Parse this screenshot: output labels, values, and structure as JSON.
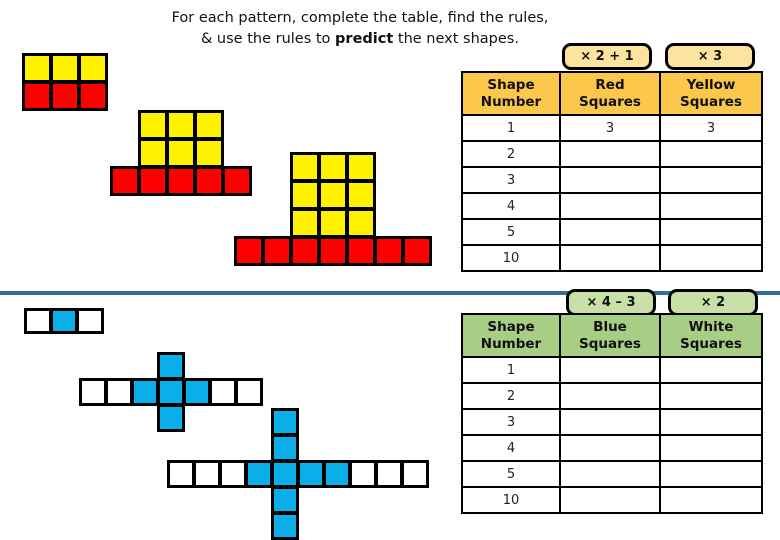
{
  "title": {
    "line1": "For each pattern, complete the table, find the rules,",
    "line2_pre": "& use the rules to ",
    "line2_bold": "predict",
    "line2_post": " the next shapes."
  },
  "colors": {
    "yellow": "#FFF200",
    "red": "#FF0000",
    "blue": "#0BAEE8",
    "white": "#FFFFFF",
    "divider": "#35708E",
    "amber_header": "#FBC84B",
    "amber_badge": "#FCE4A0",
    "green_header": "#A8CE86",
    "green_badge": "#C8E0A8"
  },
  "top_section": {
    "table": {
      "headers": [
        "Shape Number",
        "Red Squares",
        "Yellow Squares"
      ],
      "header_lines": [
        [
          "Shape",
          "Number"
        ],
        [
          "Red",
          "Squares"
        ],
        [
          "Yellow",
          "Squares"
        ]
      ],
      "rule_badges": [
        "× 2 + 1",
        "× 3"
      ],
      "rows": [
        {
          "shape_number": "1",
          "red": "3",
          "yellow": "3"
        },
        {
          "shape_number": "2",
          "red": "",
          "yellow": ""
        },
        {
          "shape_number": "3",
          "red": "",
          "yellow": ""
        },
        {
          "shape_number": "4",
          "red": "",
          "yellow": ""
        },
        {
          "shape_number": "5",
          "red": "",
          "yellow": ""
        },
        {
          "shape_number": "10",
          "red": "",
          "yellow": ""
        }
      ]
    },
    "patterns": [
      {
        "name": "shape-1",
        "yellow_squares": 3,
        "red_squares": 3
      },
      {
        "name": "shape-2",
        "yellow_squares": 6,
        "red_squares": 5
      },
      {
        "name": "shape-3",
        "yellow_squares": 9,
        "red_squares": 7
      }
    ]
  },
  "bottom_section": {
    "table": {
      "headers": [
        "Shape Number",
        "Blue Squares",
        "White Squares"
      ],
      "header_lines": [
        [
          "Shape",
          "Number"
        ],
        [
          "Blue",
          "Squares"
        ],
        [
          "White",
          "Squares"
        ]
      ],
      "rule_badges": [
        "× 4 – 3",
        "× 2"
      ],
      "rows": [
        {
          "shape_number": "1",
          "blue": "",
          "white": ""
        },
        {
          "shape_number": "2",
          "blue": "",
          "white": ""
        },
        {
          "shape_number": "3",
          "blue": "",
          "white": ""
        },
        {
          "shape_number": "4",
          "blue": "",
          "white": ""
        },
        {
          "shape_number": "5",
          "blue": "",
          "white": ""
        },
        {
          "shape_number": "10",
          "blue": "",
          "white": ""
        }
      ]
    },
    "patterns": [
      {
        "name": "shape-1",
        "blue_squares": 1,
        "white_squares": 2
      },
      {
        "name": "shape-2",
        "blue_squares": 5,
        "white_squares": 4
      },
      {
        "name": "shape-3",
        "blue_squares": 9,
        "white_squares": 6
      }
    ]
  }
}
